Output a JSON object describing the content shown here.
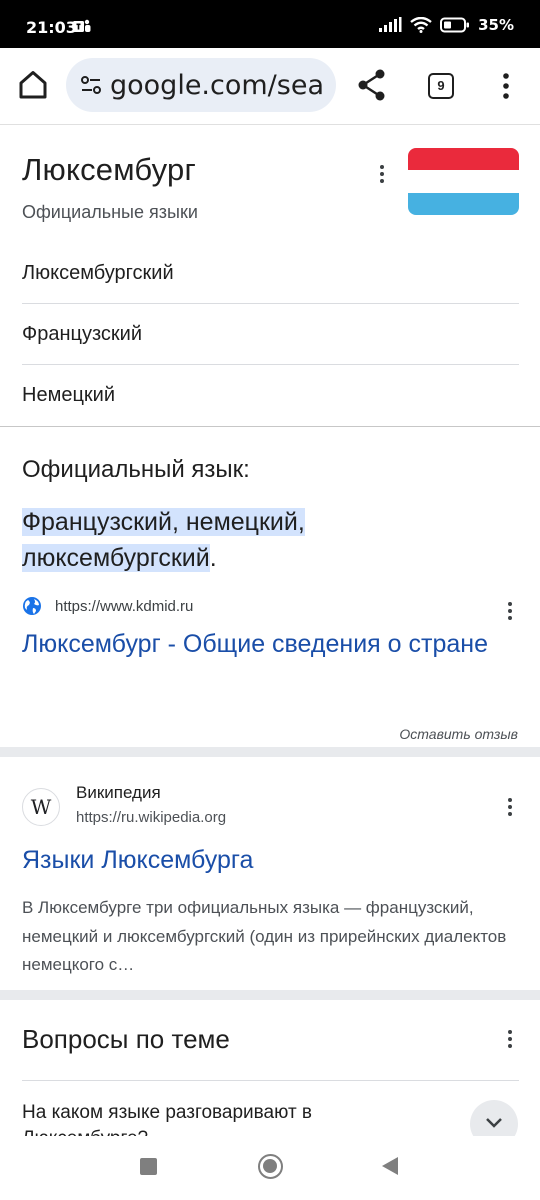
{
  "status_bar": {
    "time": "21:03",
    "battery": "35%",
    "icons": [
      "teams-icon",
      "signal-icon",
      "wifi-icon",
      "battery-icon"
    ]
  },
  "browser": {
    "url": "google.com/sea",
    "tab_count": "9",
    "icons": [
      "home-icon",
      "tune-icon",
      "share-icon",
      "tabs-icon",
      "more-vert-icon"
    ]
  },
  "knowledge_panel": {
    "title": "Люксембург",
    "subtitle": "Официальные языки",
    "languages": [
      "Люксембургский",
      "Французский",
      "Немецкий"
    ],
    "flag_colors": [
      "#ea2a3c",
      "#ffffff",
      "#46b1e1"
    ]
  },
  "featured_snippet": {
    "question": "Официальный язык:",
    "answer_line1": "Французский, немецкий,",
    "answer_line2": "люксембургский",
    "answer_tail": ".",
    "source_url": "https://www.kdmid.ru",
    "link_title": "Люксембург - Общие сведения о стране",
    "feedback": "Оставить отзыв"
  },
  "wiki_result": {
    "logo": "W",
    "site_name": "Википедия",
    "url": "https://ru.wikipedia.org",
    "title": "Языки Люксембурга",
    "snippet": "В Люксембурге три официальных языка — французский, немецкий и люксембургский (один из прирейнских диалектов немецкого с…"
  },
  "related_questions": {
    "title": "Вопросы по теме",
    "first_question": "На каком языке разговаривают в Люксембурге?"
  },
  "colors": {
    "link": "#1a4ea8",
    "highlight": "#d3e3fd",
    "url_pill": "#e9eef6"
  }
}
